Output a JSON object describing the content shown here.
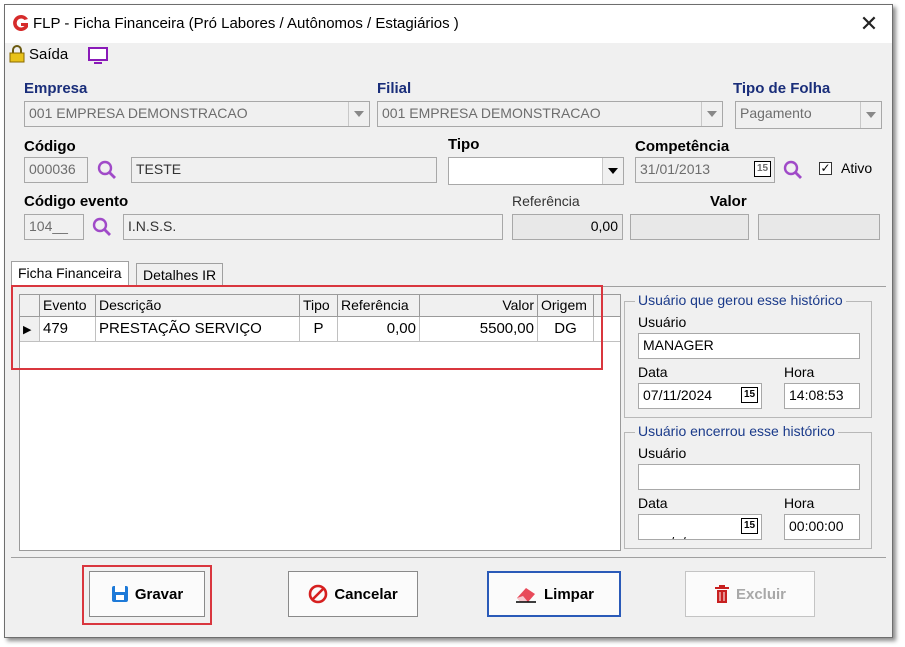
{
  "window": {
    "title": "FLP - Ficha Financeira (Pró Labores / Autônomos / Estagiários )",
    "close_glyph": "✕"
  },
  "toolbar": {
    "exit_label": "Saída",
    "exit_icon": "lock-icon",
    "screen_icon": "monitor-icon"
  },
  "header": {
    "empresa_label": "Empresa",
    "empresa_value": "001 EMPRESA DEMONSTRACAO",
    "filial_label": "Filial",
    "filial_value": "001 EMPRESA DEMONSTRACAO",
    "tipo_folha_label": "Tipo de Folha",
    "tipo_folha_value": "Pagamento",
    "codigo_label": "Código",
    "codigo_value": "000036",
    "codigo_name": "TESTE",
    "tipo_label": "Tipo",
    "tipo_value": "",
    "competencia_label": "Competência",
    "competencia_value": "31/01/2013",
    "ativo_label": "Ativo",
    "ativo_checked": "✓",
    "codigo_evento_label": "Código evento",
    "codigo_evento_value": "104__",
    "evento_name": "I.N.S.S.",
    "referencia_label": "Referência",
    "referencia_value": "0,00",
    "valor_label": "Valor",
    "valor_value": "",
    "extra_value": ""
  },
  "tabs": [
    {
      "label": "Ficha Financeira",
      "active": true
    },
    {
      "label": "Detalhes IR",
      "active": false
    }
  ],
  "grid": {
    "columns": [
      "Evento",
      "Descrição",
      "Tipo",
      "Referência",
      "Valor",
      "Origem"
    ],
    "rows": [
      {
        "indicator": "▶",
        "evento": "479",
        "descricao": "PRESTAÇÃO SERVIÇO",
        "tipo": "P",
        "referencia": "0,00",
        "valor": "5500,00",
        "origem": "DG"
      }
    ]
  },
  "history_created": {
    "title": "Usuário que gerou esse histórico",
    "usuario_label": "Usuário",
    "usuario_value": "MANAGER",
    "data_label": "Data",
    "data_value": "07/11/2024",
    "hora_label": "Hora",
    "hora_value": "14:08:53"
  },
  "history_closed": {
    "title": "Usuário encerrou esse histórico",
    "usuario_label": "Usuário",
    "usuario_value": "",
    "data_label": "Data",
    "data_value": " /  /",
    "hora_label": "Hora",
    "hora_value": "00:00:00"
  },
  "calendar_glyph": "15",
  "buttons": {
    "gravar": "Gravar",
    "cancelar": "Cancelar",
    "limpar": "Limpar",
    "excluir": "Excluir"
  },
  "colors": {
    "label_blue": "#1a2e7a",
    "highlight_red": "#d9363e",
    "focus_blue": "#2a5ab8"
  }
}
